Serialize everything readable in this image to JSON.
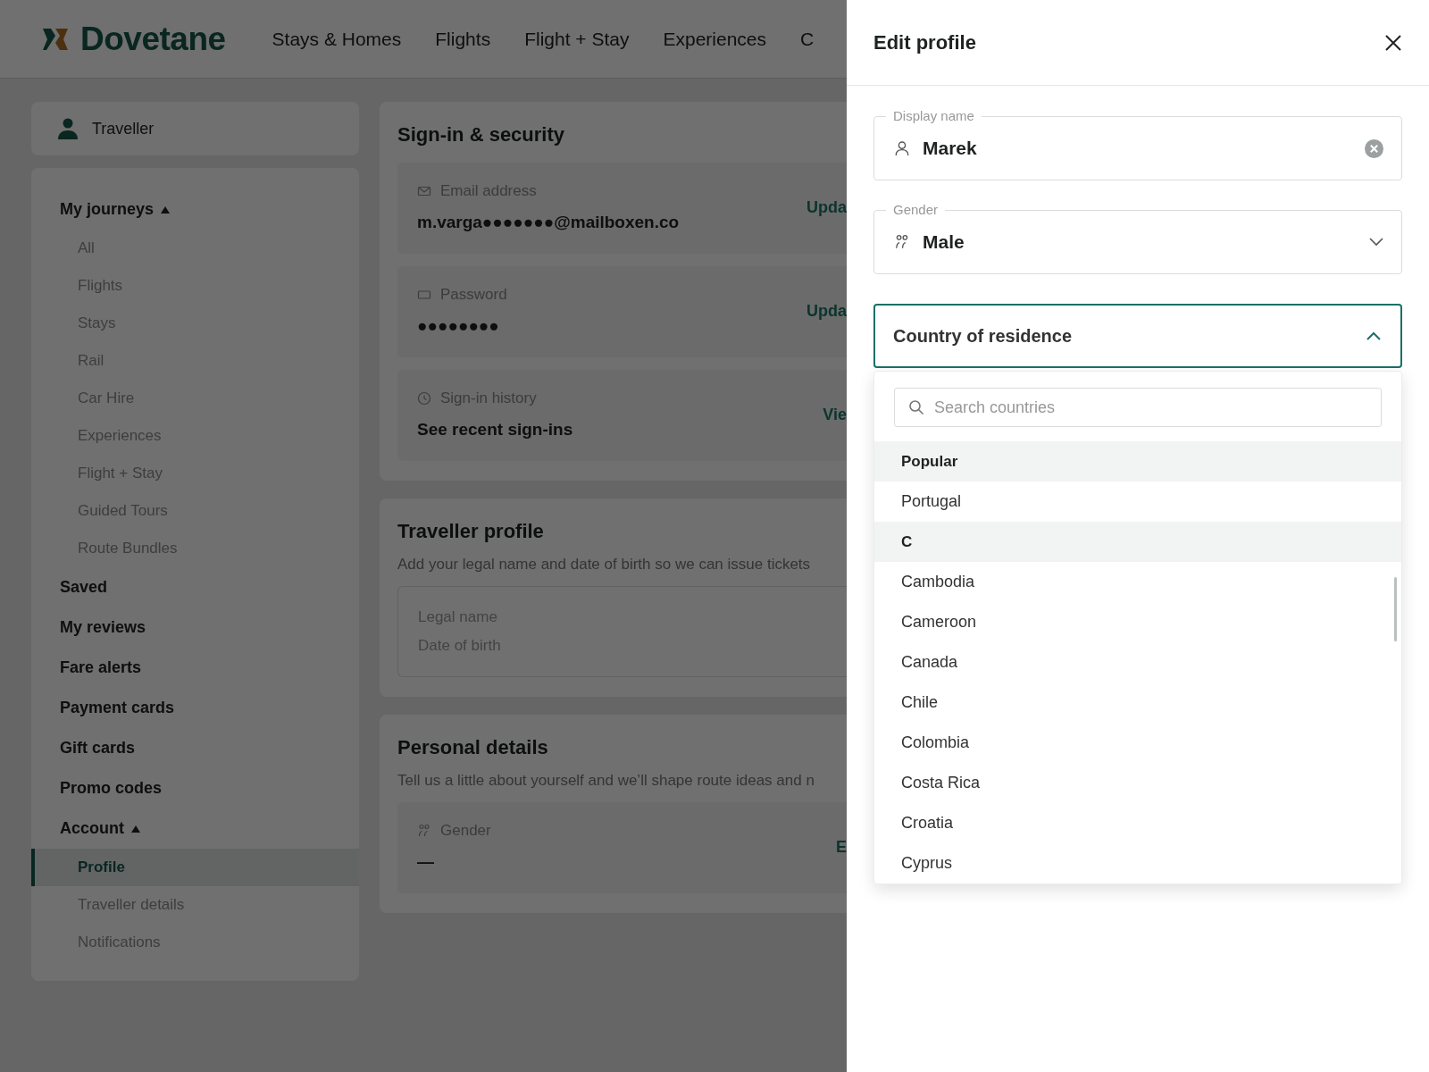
{
  "header": {
    "logo": "Dovetane",
    "nav": [
      {
        "label": "Stays & Homes"
      },
      {
        "label": "Flights"
      },
      {
        "label": "Flight + Stay"
      },
      {
        "label": "Experiences"
      },
      {
        "label": "C"
      }
    ]
  },
  "sidebar": {
    "user": "Traveller",
    "nav": [
      {
        "label": "My journeys",
        "kind": "group",
        "expanded": true,
        "selected": false,
        "children": [
          {
            "label": "All",
            "selected": false
          },
          {
            "label": "Flights",
            "selected": false
          },
          {
            "label": "Stays",
            "selected": false
          },
          {
            "label": "Rail",
            "selected": false
          },
          {
            "label": "Car Hire",
            "selected": false
          },
          {
            "label": "Experiences",
            "selected": false
          },
          {
            "label": "Flight + Stay",
            "selected": false
          },
          {
            "label": "Guided Tours",
            "selected": false
          },
          {
            "label": "Route Bundles",
            "selected": false
          }
        ]
      },
      {
        "label": "Saved",
        "kind": "link",
        "selected": false
      },
      {
        "label": "My reviews",
        "kind": "link",
        "selected": false
      },
      {
        "label": "Fare alerts",
        "kind": "link",
        "selected": false
      },
      {
        "label": "Payment cards",
        "kind": "link",
        "selected": false
      },
      {
        "label": "Gift cards",
        "kind": "link",
        "selected": false
      },
      {
        "label": "Promo codes",
        "kind": "link",
        "selected": false
      },
      {
        "label": "Account",
        "kind": "group",
        "expanded": true,
        "selected": false,
        "children": [
          {
            "label": "Profile",
            "selected": true
          },
          {
            "label": "Traveller details",
            "selected": false
          },
          {
            "label": "Notifications",
            "selected": false
          }
        ]
      }
    ]
  },
  "security": {
    "title": "Sign-in & security",
    "rows": [
      {
        "kind": "email",
        "label": "Email address",
        "value": "m.varga●●●●●●●@mailboxen.co",
        "action": "Upda"
      },
      {
        "kind": "password",
        "label": "Password",
        "value": "●●●●●●●●",
        "action": "Upda"
      },
      {
        "kind": "history",
        "label": "Sign-in history",
        "value": "See recent sign-ins",
        "action": "Vie"
      }
    ]
  },
  "traveller_profile": {
    "title": "Traveller profile",
    "description": "Add your legal name and date of birth so we can issue tickets",
    "fields": [
      "Legal name",
      "Date of birth"
    ]
  },
  "personal_details": {
    "title": "Personal details",
    "description": "Tell us a little about yourself and we’ll shape route ideas and n",
    "rows": [
      {
        "kind": "gender",
        "label": "Gender",
        "value": "—",
        "action": "E"
      }
    ]
  },
  "drawer": {
    "title": "Edit profile",
    "display_name": {
      "label": "Display name",
      "value": "Marek"
    },
    "gender": {
      "label": "Gender",
      "value": "Male"
    },
    "country": {
      "label": "Country of residence",
      "expanded": true
    },
    "dropdown": {
      "placeholder": "Search countries",
      "options": [
        {
          "kind": "group",
          "label": "Popular"
        },
        {
          "kind": "option",
          "label": "Portugal"
        },
        {
          "kind": "group",
          "label": "C"
        },
        {
          "kind": "option",
          "label": "Cambodia"
        },
        {
          "kind": "option",
          "label": "Cameroon"
        },
        {
          "kind": "option",
          "label": "Canada"
        },
        {
          "kind": "option",
          "label": "Chile"
        },
        {
          "kind": "option",
          "label": "Colombia"
        },
        {
          "kind": "option",
          "label": "Costa Rica"
        },
        {
          "kind": "option",
          "label": "Croatia"
        },
        {
          "kind": "option",
          "label": "Cyprus"
        }
      ]
    }
  }
}
